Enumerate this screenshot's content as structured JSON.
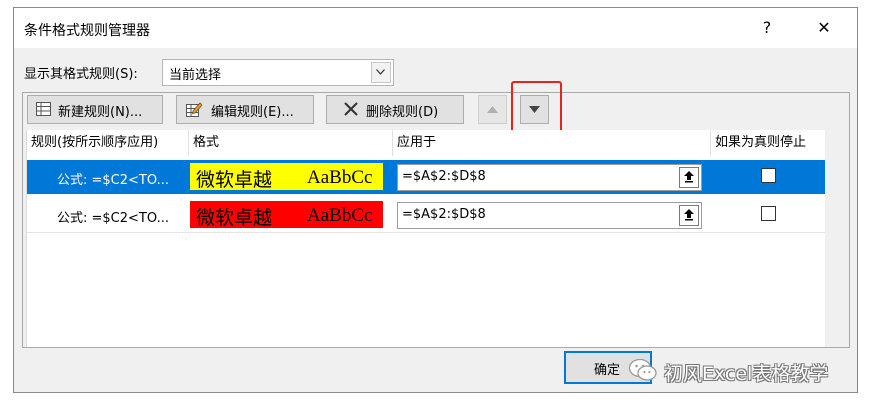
{
  "dialog": {
    "title": "条件格式规则管理器",
    "help_label": "?",
    "close_label": "✕"
  },
  "show_rules": {
    "label": "显示其格式规则(S):",
    "value": "当前选择"
  },
  "toolbar": {
    "new_rule": "新建规则(N)...",
    "edit_rule": "编辑规则(E)...",
    "delete_rule": "删除规则(D)"
  },
  "table": {
    "headers": [
      "规则(按所示顺序应用)",
      "格式",
      "应用于",
      "如果为真则停止"
    ],
    "rows": [
      {
        "rule": "公式: =$C2<TO...",
        "preview_cn": "微软卓越",
        "preview_en": "AaBbCc",
        "preview_bg": "#ffff00",
        "applies_to": "=$A$2:$D$8",
        "selected": true
      },
      {
        "rule": "公式: =$C2<TO...",
        "preview_cn": "微软卓越",
        "preview_en": "AaBbCc",
        "preview_bg": "#ff0000",
        "applies_to": "=$A$2:$D$8",
        "selected": false
      }
    ]
  },
  "footer": {
    "ok_label": "确定"
  },
  "watermark": {
    "text": "初风Excel表格教学"
  },
  "colors": {
    "selection": "#0078d7",
    "highlight_box": "#e8231a"
  }
}
